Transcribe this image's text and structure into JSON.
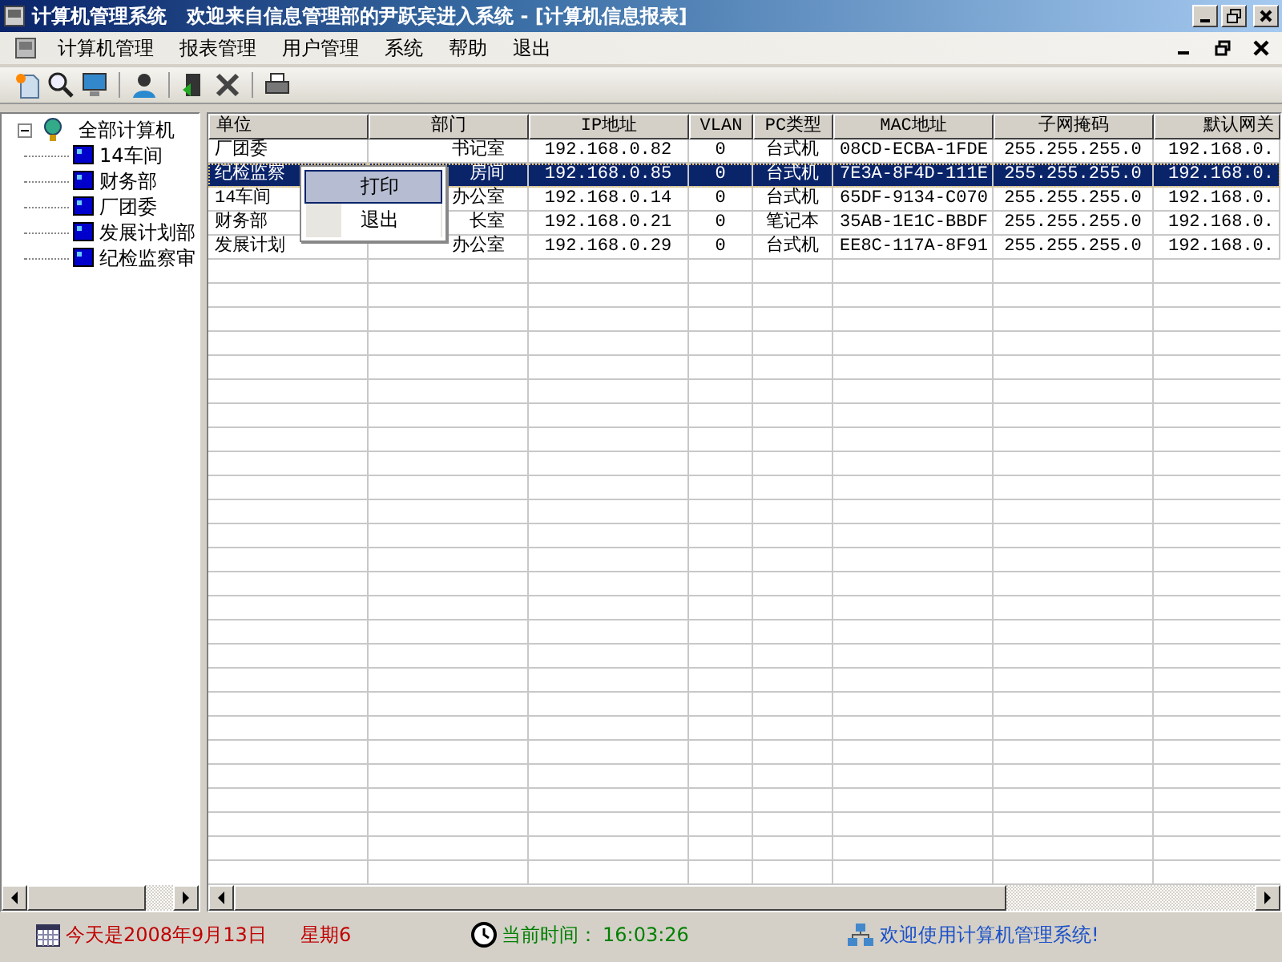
{
  "window": {
    "title": "计算机管理系统   欢迎来自信息管理部的尹跃宾进入系统 - [计算机信息报表]"
  },
  "menu": [
    "计算机管理",
    "报表管理",
    "用户管理",
    "系统",
    "帮助",
    "退出"
  ],
  "tree": {
    "label": "全部计算机",
    "expanded": true,
    "children": [
      {
        "label": "14车间"
      },
      {
        "label": "财务部"
      },
      {
        "label": "厂团委"
      },
      {
        "label": "发展计划部"
      },
      {
        "label": "纪检监察审"
      }
    ]
  },
  "table": {
    "columns": [
      "单位",
      "部门",
      "IP地址",
      "VLAN",
      "PC类型",
      "MAC地址",
      "子网掩码",
      "默认网关"
    ],
    "rows": [
      {
        "selected": false,
        "cells": [
          "厂团委",
          "书记室",
          "192.168.0.82",
          "0",
          "台式机",
          "08CD-ECBA-1FDE",
          "255.255.255.0",
          "192.168.0."
        ]
      },
      {
        "selected": true,
        "cells": [
          "纪检监察",
          "房间",
          "192.168.0.85",
          "0",
          "台式机",
          "7E3A-8F4D-111E",
          "255.255.255.0",
          "192.168.0."
        ]
      },
      {
        "selected": false,
        "cells": [
          "14车间",
          "办公室",
          "192.168.0.14",
          "0",
          "台式机",
          "65DF-9134-C070",
          "255.255.255.0",
          "192.168.0."
        ]
      },
      {
        "selected": false,
        "cells": [
          "财务部",
          "长室",
          "192.168.0.21",
          "0",
          "笔记本",
          "35AB-1E1C-BBDF",
          "255.255.255.0",
          "192.168.0."
        ]
      },
      {
        "selected": false,
        "cells": [
          "发展计划",
          "办公室",
          "192.168.0.29",
          "0",
          "台式机",
          "EE8C-117A-8F91",
          "255.255.255.0",
          "192.168.0."
        ]
      }
    ]
  },
  "context_menu": [
    {
      "label": "打印",
      "selected": true
    },
    {
      "label": "退出",
      "selected": false
    }
  ],
  "status": {
    "date": "今天是2008年9月13日",
    "weekday": "星期6",
    "time_label": "当前时间：",
    "time": "16:03:26",
    "welcome": "欢迎使用计算机管理系统!"
  }
}
